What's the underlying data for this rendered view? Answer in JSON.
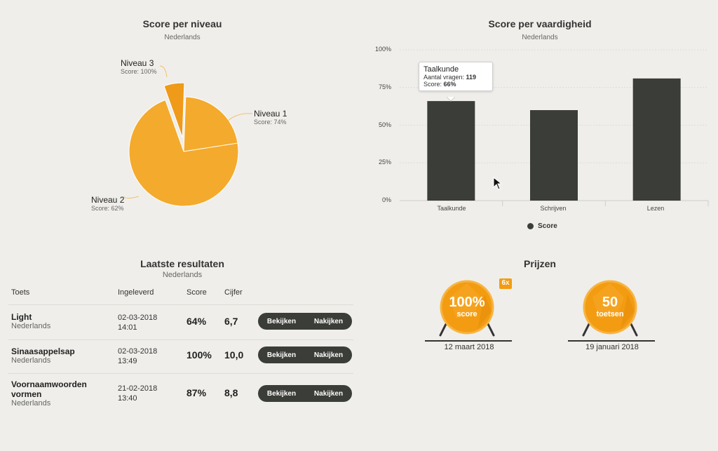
{
  "pie_section": {
    "title": "Score per niveau",
    "subtitle": "Nederlands",
    "slices": [
      {
        "label": "Niveau 1",
        "score_text": "Score: 74%"
      },
      {
        "label": "Niveau 2",
        "score_text": "Score: 62%"
      },
      {
        "label": "Niveau 3",
        "score_text": "Score: 100%"
      }
    ]
  },
  "bar_section": {
    "title": "Score per vaardigheid",
    "subtitle": "Nederlands",
    "legend_label": "Score",
    "tooltip": {
      "title": "Taalkunde",
      "line1_label": "Aantal vragen: ",
      "line1_value": "119",
      "line2_label": "Score: ",
      "line2_value": "66%"
    }
  },
  "chart_data": [
    {
      "type": "pie",
      "title": "Score per niveau",
      "subtitle": "Nederlands",
      "categories": [
        "Niveau 1",
        "Niveau 2",
        "Niveau 3"
      ],
      "values": [
        74,
        62,
        100
      ],
      "slice_fractions": [
        0.22,
        0.72,
        0.06
      ]
    },
    {
      "type": "bar",
      "title": "Score per vaardigheid",
      "subtitle": "Nederlands",
      "categories": [
        "Taalkunde",
        "Schrijven",
        "Lezen"
      ],
      "series": [
        {
          "name": "Score",
          "values": [
            66,
            60,
            81
          ]
        }
      ],
      "yticks": [
        "0%",
        "25%",
        "50%",
        "75%",
        "100%"
      ],
      "ylim": [
        0,
        100
      ],
      "legend": "bottom"
    }
  ],
  "results": {
    "title": "Laatste resultaten",
    "subtitle": "Nederlands",
    "headers": {
      "toets": "Toets",
      "ingeleverd": "Ingeleverd",
      "score": "Score",
      "cijfer": "Cijfer"
    },
    "rows": [
      {
        "name": "Light",
        "subject": "Nederlands",
        "date": "02-03-2018",
        "time": "14:01",
        "score": "64%",
        "cijfer": "6,7"
      },
      {
        "name": "Sinaasappelsap",
        "subject": "Nederlands",
        "date": "02-03-2018",
        "time": "13:49",
        "score": "100%",
        "cijfer": "10,0"
      },
      {
        "name": "Voornaamwoorden vormen",
        "subject": "Nederlands",
        "date": "21-02-2018",
        "time": "13:40",
        "score": "87%",
        "cijfer": "8,8"
      }
    ],
    "btn_view": "Bekijken",
    "btn_check": "Nakijken"
  },
  "prizes": {
    "title": "Prijzen",
    "items": [
      {
        "big": "100%",
        "small": "score",
        "badge": "6x",
        "date": "12 maart 2018"
      },
      {
        "big": "50",
        "small": "toetsen",
        "badge": "",
        "date": "19 januari 2018"
      }
    ]
  },
  "colors": {
    "pie": "#f4aa2c",
    "pie_dark": "#ef9a19",
    "bar": "#3b3d38",
    "prize": "#f39c12"
  }
}
